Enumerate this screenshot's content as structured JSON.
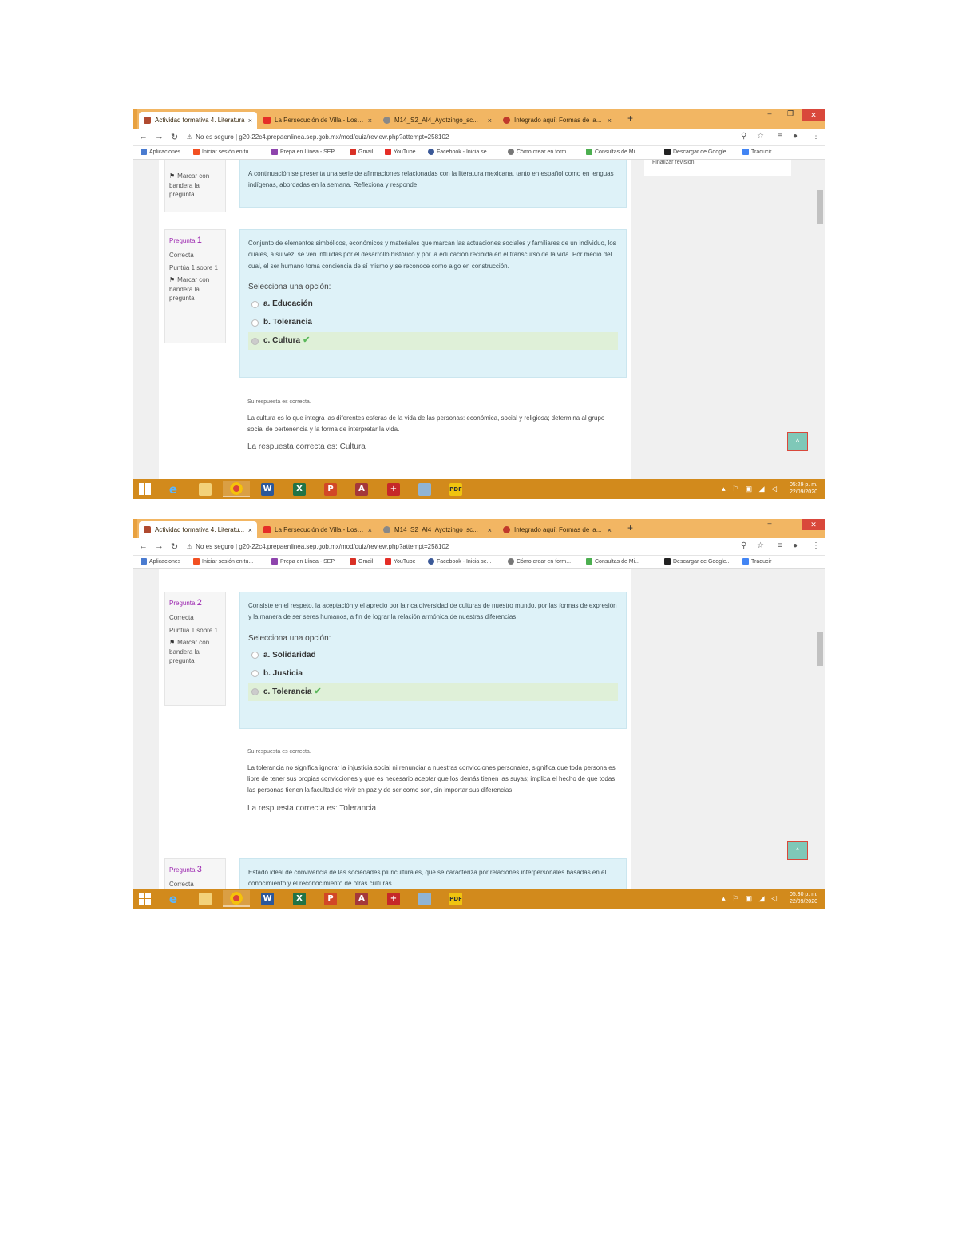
{
  "shots": [
    {
      "tabs": [
        {
          "title": "Actividad formativa 4. Literatura",
          "icon": "moodle-icon",
          "color": "#b04a30",
          "active": true
        },
        {
          "title": "La Persecución de Villa - Los A...",
          "icon": "youtube-icon",
          "color": "#e52d27",
          "active": false
        },
        {
          "title": "M14_S2_AI4_Ayotzingo_sc...",
          "icon": "globe-icon",
          "color": "#666666",
          "active": false
        },
        {
          "title": "Integrado aquí: Formas de la...",
          "icon": "flower-icon",
          "color": "#c0392b",
          "active": false
        }
      ],
      "url_warning": "No es seguro",
      "url": "g20-22c4.prepaenlinea.sep.gob.mx/mod/quiz/review.php?attempt=258102",
      "bookmarks": [
        "Aplicaciones",
        "Iniciar sesión en tu...",
        "Prepa en Línea - SEP",
        "Gmail",
        "YouTube",
        "Facebook - Inicia se...",
        "Cómo crear en form...",
        "Consultas de Mi...",
        "Descargar de Google...",
        "Traducir"
      ],
      "flag_text": "Marcar con bandera la pregunta",
      "intro": "A continuación se presenta una serie de afirmaciones relacionadas con la literatura mexicana, tanto en español como en lenguas indígenas, abordadas en la semana. Reflexiona y responde.",
      "question": {
        "label": "Pregunta",
        "number": "1",
        "status": "Correcta",
        "score": "Puntúa 1 sobre 1",
        "text": "Conjunto de elementos simbólicos, económicos y materiales que marcan las actuaciones sociales y familiares de un individuo, los cuales, a su vez, se ven influidas por el desarrollo histórico y por la educación recibida en el transcurso de la vida. Por medio del cual, el ser humano toma conciencia de sí mismo y se reconoce como algo en construcción.",
        "prompt": "Selecciona una opción:",
        "options": [
          "a. Educación",
          "b. Tolerancia",
          "c. Cultura"
        ]
      },
      "feedback": {
        "status": "Su respuesta es correcta.",
        "text": "La cultura es lo que integra las diferentes esferas de la vida de las personas: económica, social y religiosa; determina al grupo social de pertenencia y la forma de interpretar la vida.",
        "answer": "La respuesta correcta es: Cultura"
      },
      "side_text": "Finalizar revisión",
      "clock": {
        "time": "05:29 p. m.",
        "date": "22/09/2020"
      }
    },
    {
      "tabs": [
        {
          "title": "Actividad formativa 4. Literatu...",
          "icon": "moodle-icon",
          "color": "#b04a30",
          "active": true
        },
        {
          "title": "La Persecución de Villa - Los A...",
          "icon": "youtube-icon",
          "color": "#e52d27",
          "active": false
        },
        {
          "title": "M14_S2_AI4_Ayotzingo_sc...",
          "icon": "globe-icon",
          "color": "#666666",
          "active": false
        },
        {
          "title": "Integrado aquí: Formas de la...",
          "icon": "flower-icon",
          "color": "#c0392b",
          "active": false
        }
      ],
      "url_warning": "No es seguro",
      "url": "g20-22c4.prepaenlinea.sep.gob.mx/mod/quiz/review.php?attempt=258102",
      "bookmarks": [
        "Aplicaciones",
        "Iniciar sesión en tu...",
        "Prepa en Línea - SEP",
        "Gmail",
        "YouTube",
        "Facebook - Inicia se...",
        "Cómo crear en form...",
        "Consultas de Mi...",
        "Descargar de Google...",
        "Traducir"
      ],
      "flag_text": "Marcar con bandera la pregunta",
      "question": {
        "label": "Pregunta",
        "number": "2",
        "status": "Correcta",
        "score": "Puntúa 1 sobre 1",
        "text": "Consiste en el respeto, la aceptación y el aprecio por la rica diversidad de culturas de nuestro mundo, por las formas de expresión y la manera de ser seres humanos, a fin de lograr la relación armónica de nuestras diferencias.",
        "prompt": "Selecciona una opción:",
        "options": [
          "a. Solidaridad",
          "b. Justicia",
          "c. Tolerancia"
        ]
      },
      "feedback": {
        "status": "Su respuesta es correcta.",
        "text": "La tolerancia no significa ignorar la injusticia social ni renunciar a nuestras convicciones personales, significa que toda persona es libre de tener sus propias convicciones y que es necesario aceptar que los demás tienen las suyas; implica el hecho de que todas las personas tienen la facultad de vivir en paz y de ser como son, sin importar sus diferencias.",
        "answer": "La respuesta correcta es: Tolerancia"
      },
      "next_question": {
        "label": "Pregunta",
        "number": "3",
        "status": "Correcta",
        "text": "Estado ideal de convivencia de las sociedades pluriculturales, que se caracteriza por relaciones interpersonales basadas en el conocimiento y el reconocimiento de otras culturas."
      },
      "clock": {
        "time": "05:30 p. m.",
        "date": "22/09/2020"
      }
    }
  ],
  "window": {
    "minimize": "–",
    "maximize": "❐",
    "close": "✕"
  },
  "new_tab": "+",
  "to_top": "^",
  "taskbar_apps": [
    "Windows",
    "Internet Explorer",
    "Explorador",
    "Chrome",
    "Word",
    "Excel",
    "PowerPoint",
    "Access",
    "Visor",
    "Sticky",
    "PDF"
  ],
  "colors": {
    "tab_strip": "#f2b663",
    "taskbar": "#d28a1c",
    "question_bg": "#def2f8",
    "correct_bg": "#dff0d8",
    "question_number": "#9c27b0"
  }
}
